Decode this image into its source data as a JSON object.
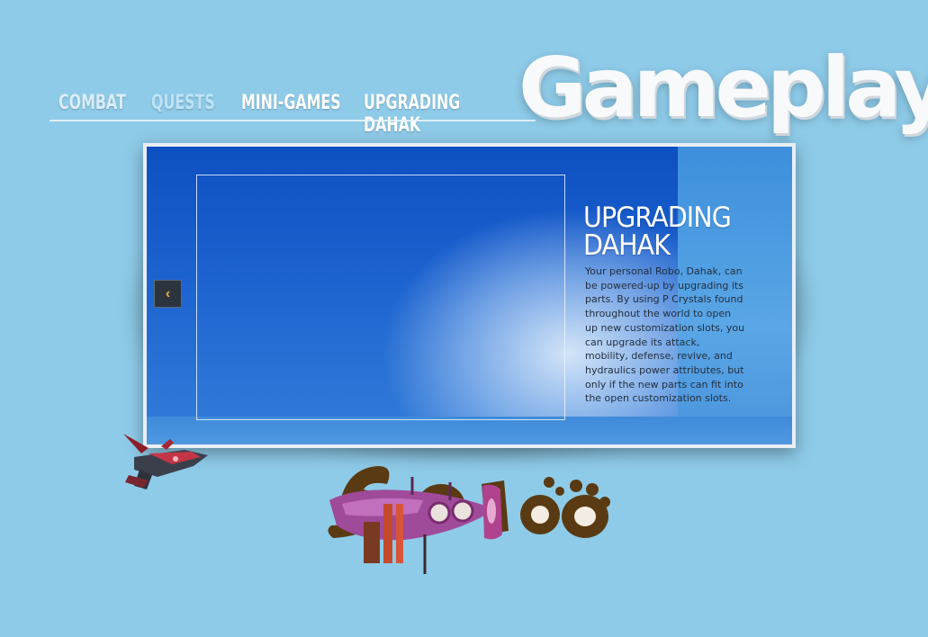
{
  "nav": {
    "items": [
      {
        "label": "COMBAT"
      },
      {
        "label": "QUESTS"
      },
      {
        "label": "MINI-GAMES"
      },
      {
        "label": "UPGRADING DAHAK"
      }
    ]
  },
  "page": {
    "title": "Gameplay"
  },
  "panel": {
    "heading_line1": "UPGRADING",
    "heading_line2": "DAHAK",
    "body": "Your personal Robo, Dahak, can be powered-up by upgrading its parts. By using P Crystals found throughout the world to open up new customization slots, you can upgrade its attack, mobility, defense, revive, and hydraulics power attributes, but only if the new parts can fit into the open customization slots.",
    "prev_icon": "chevron-left-icon"
  },
  "colors": {
    "background": "#8ecbe9",
    "accent_arrow": "#e8b43a",
    "panel_blue": "#1d63cf"
  }
}
